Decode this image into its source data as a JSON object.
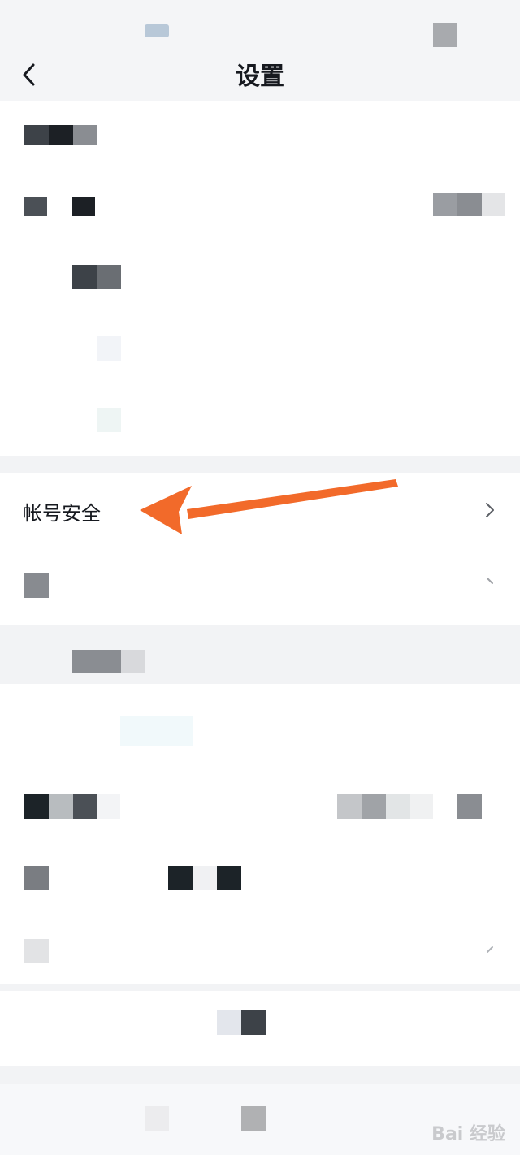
{
  "header": {
    "title": "设置",
    "back_icon": "chevron-left-icon"
  },
  "sections": {
    "account": {
      "label": "帐号安全",
      "icon": "chevron-right-icon"
    }
  },
  "annotation": {
    "arrow_color": "#f26a2a"
  },
  "watermark": {
    "text": "Bai 经验"
  },
  "colors": {
    "background": "#f2f3f5",
    "card": "#ffffff",
    "text": "#16191f"
  }
}
